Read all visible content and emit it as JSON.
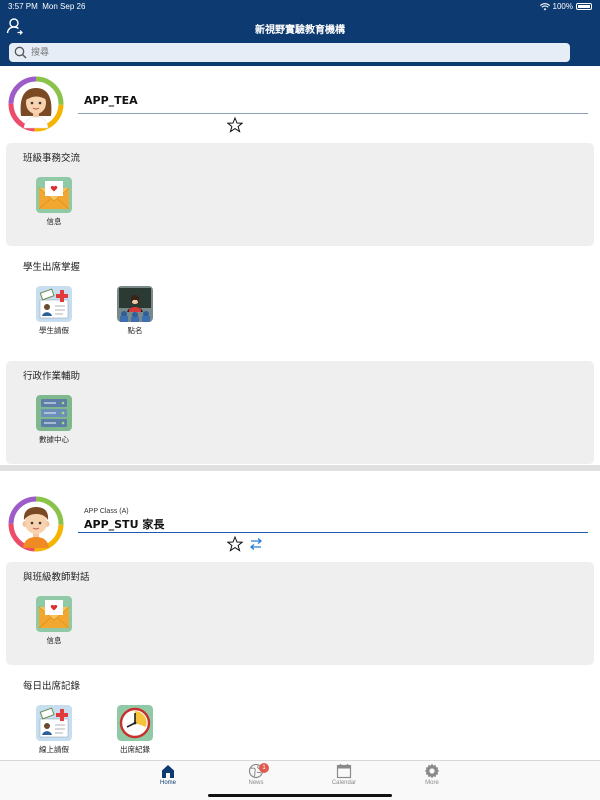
{
  "status": {
    "time": "3:57 PM",
    "date": "Mon Sep 26",
    "battery": "100%"
  },
  "header": {
    "title": "新視野實驗教育機構"
  },
  "search": {
    "placeholder": "搜尋"
  },
  "profiles": [
    {
      "subtitle": "",
      "name": "APP_TEA",
      "underline_color": "#8aa0b8",
      "groups": [
        {
          "title": "班級事務交流",
          "items": [
            {
              "label": "信息",
              "icon": "envelope-heart-icon"
            }
          ]
        },
        {
          "title": "學生出席掌握",
          "items": [
            {
              "label": "學生請假",
              "icon": "leave-form-icon"
            },
            {
              "label": "點名",
              "icon": "roll-call-icon"
            }
          ]
        },
        {
          "title": "行政作業輔助",
          "items": [
            {
              "label": "數據中心",
              "icon": "data-center-icon"
            }
          ]
        }
      ]
    },
    {
      "subtitle": "APP Class (A)",
      "name": "APP_STU 家長",
      "underline_color": "#1a5bb0",
      "groups": [
        {
          "title": "與班級教師對話",
          "items": [
            {
              "label": "信息",
              "icon": "envelope-heart-icon"
            }
          ]
        },
        {
          "title": "每日出席記錄",
          "items": [
            {
              "label": "線上請假",
              "icon": "leave-form-icon"
            },
            {
              "label": "出席紀錄",
              "icon": "attendance-clock-icon"
            }
          ]
        }
      ]
    }
  ],
  "tabs": [
    {
      "label": "Home",
      "icon": "home-icon",
      "active": true
    },
    {
      "label": "News",
      "icon": "globe-icon",
      "badge": "1"
    },
    {
      "label": "Calendar",
      "icon": "calendar-icon"
    },
    {
      "label": "More",
      "icon": "gear-icon"
    }
  ],
  "colors": {
    "primary": "#0d3a70",
    "panel": "#efefef",
    "badge": "#e05a4e"
  }
}
